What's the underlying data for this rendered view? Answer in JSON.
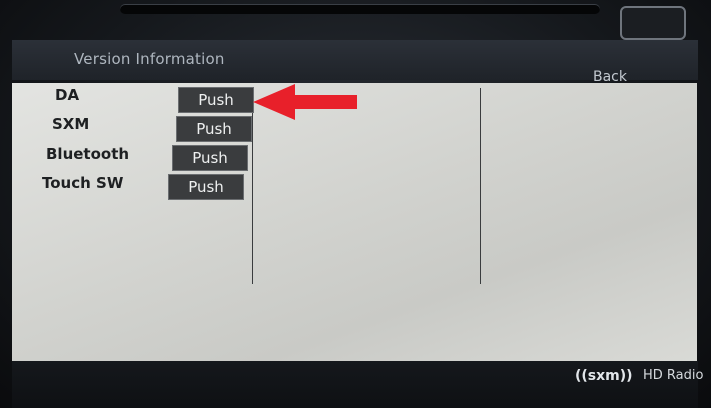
{
  "header": {
    "title": "Version Information",
    "back_label": "Back"
  },
  "rows": [
    {
      "label": "DA",
      "button_label": "Push"
    },
    {
      "label": "SXM",
      "button_label": "Push"
    },
    {
      "label": "Bluetooth",
      "button_label": "Push"
    },
    {
      "label": "Touch SW",
      "button_label": "Push"
    }
  ],
  "footer": {
    "sxm_logo": "((sxm))",
    "hd_radio_logo": "HD Radio"
  },
  "annotation": {
    "arrow_color": "#e8202a"
  },
  "colors": {
    "panel": "#d6d7d3",
    "button": "#3a3c3e",
    "bezel": "#15181c"
  }
}
